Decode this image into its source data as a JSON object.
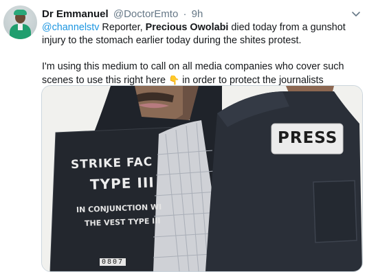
{
  "tweet": {
    "author_name": "Dr Emmanuel",
    "handle": "@DoctorEmto",
    "separator": "·",
    "time": "9h",
    "p1_mention": "@channelstv",
    "p1_a": " Reporter, ",
    "p1_bold": "Precious Owolabi",
    "p1_b": " died today from a gunshot injury to the stomach earlier today during the shites  protest.",
    "p2_a": "I'm using this medium to call on all media companies who cover  such scenes to use this right here ",
    "p2_emoji": "👇",
    "p2_b": " in order to protect the journalists"
  },
  "media": {
    "plate_line1": "STRIKE FAC",
    "plate_line2": "TYPE III",
    "plate_line3": "IN CONJUNCTION WI",
    "plate_line4": "THE VEST TYPE III",
    "plate_code": "0807",
    "press_label": "PRESS"
  },
  "icons": {
    "more": "chevron-down-icon",
    "pointer": "backhand-index-pointing-down-icon"
  }
}
